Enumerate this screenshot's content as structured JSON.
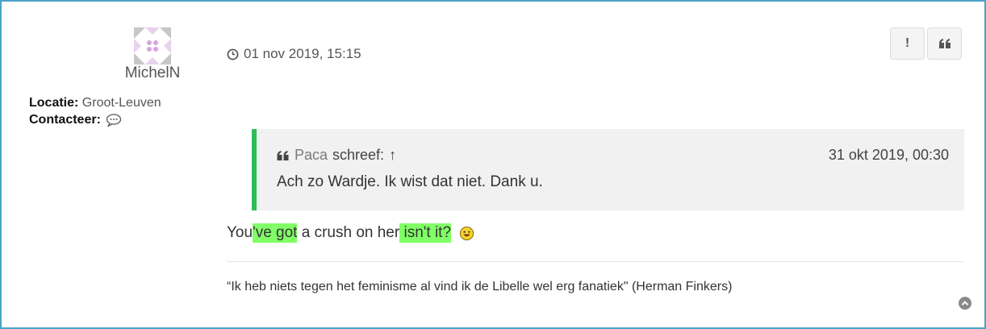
{
  "author": {
    "username": "MichelN",
    "location_label": "Locatie:",
    "location_value": "Groot-Leuven",
    "contact_label": "Contacteer:"
  },
  "post": {
    "date": "01 nov 2019, 15:15",
    "buttons": {
      "report": "!"
    }
  },
  "quote": {
    "author": "Paca",
    "wrote": "schreef:",
    "arrow": "↑",
    "date": "31 okt 2019, 00:30",
    "text": "Ach zo Wardje. Ik wist dat niet. Dank u."
  },
  "reply": {
    "p1": "You",
    "hl1": "'ve got",
    "p2": " a crush on her",
    "hl2": " isn't it?",
    "p3": " ",
    "highlight_color": "#80ff66"
  },
  "signature": "“Ik heb niets tegen het feminisme al vind ik de Libelle wel erg fanatiek\" (Herman Finkers)",
  "colors": {
    "quote_border": "#2ebd59",
    "frame_border": "#4aa3c7"
  }
}
